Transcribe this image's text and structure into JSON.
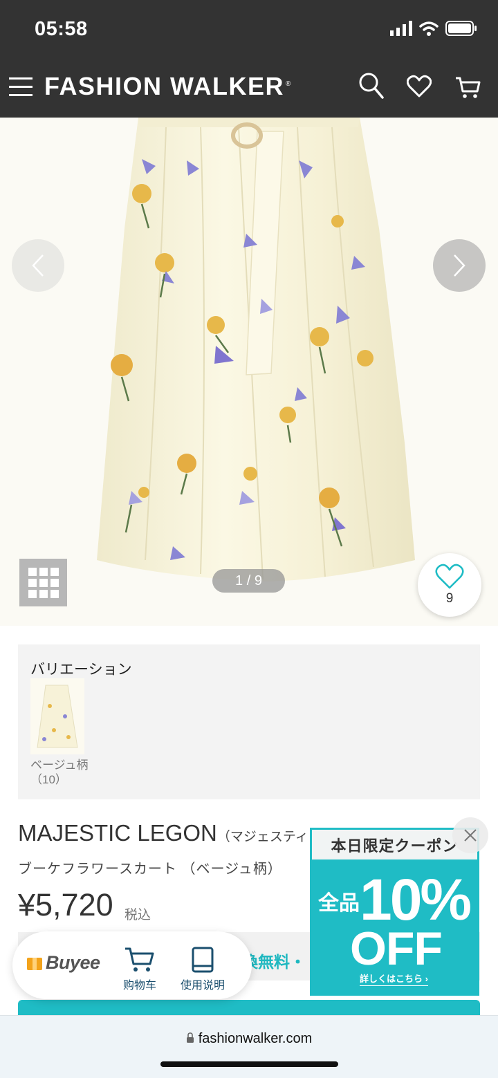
{
  "status": {
    "time": "05:58"
  },
  "header": {
    "brand": "FASHION WALKER",
    "brand_mark": "®"
  },
  "gallery": {
    "counter": "1 / 9",
    "favorite_count": "9"
  },
  "variation": {
    "title": "バリエーション",
    "item_label": "ベージュ柄（10）"
  },
  "product": {
    "brand": "MAJESTIC LEGON",
    "brand_kana": "（マジェスティ",
    "name": "ブーケフラワースカート （ベージュ柄）",
    "price": "¥5,720",
    "tax_label": "税込",
    "shipping_text": "換無料・"
  },
  "buyee": {
    "logo": "Buyee",
    "cart_label": "购物车",
    "guide_label": "使用说明"
  },
  "coupon": {
    "heading": "本日限定クーポン",
    "all_items": "全品",
    "percent": "10%",
    "off": "OFF",
    "link": "詳しくはこちら ›"
  },
  "browser": {
    "url": "fashionwalker.com"
  },
  "colors": {
    "header_bg": "#333333",
    "accent": "#1fbcc5",
    "buyee_navy": "#1b4f6e"
  }
}
